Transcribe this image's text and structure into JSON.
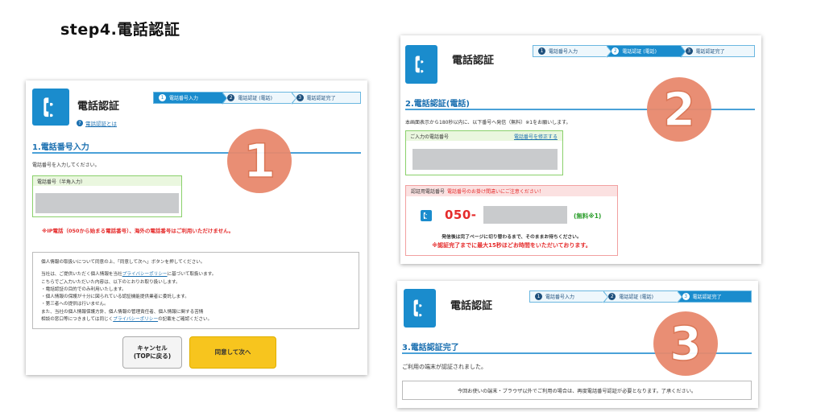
{
  "page_heading": "step4.電話認証",
  "app_title": "電話認証",
  "steps": [
    {
      "num": "1",
      "label": "電話番号入力"
    },
    {
      "num": "2",
      "label": "電話認証 (電話)"
    },
    {
      "num": "3",
      "label": "電話認証完了"
    }
  ],
  "panel1": {
    "help_link": "電話認証とは",
    "section_title": "1.電話番号入力",
    "instruction": "電話番号を入力してください。",
    "field_label": "電話番号（半角入力）",
    "warning": "※IP電話（050から始まる電話番号）、海外の電話番号はご利用いただけません。",
    "privacy": {
      "intro": "個人情報の取扱いについて同意の上、「同意して次へ」ボタンを押してください。",
      "line1_pre": "当社は、ご提供いただく個人情報を当社",
      "policy_link": "プライバシーポリシー",
      "line1_post": "に基づいて取扱います。",
      "line2": "こちらでご入力いただいた内容は、以下のとおりお取り扱いします。",
      "line3": "・電話認証の目的でのみ利用いたします。",
      "line4": "・個人情報の保護が十分に図られている認証機能提供業者に委託します。",
      "line5": "・第三者への提供は行いません。",
      "line6": "また、当社の個人情報保護方針、個人情報の管理責任者、個人情報に関する苦情",
      "line7_pre": "相談の窓口等につきましては同じく",
      "line7_post": "の記載をご確認ください。"
    },
    "cancel_line1": "キャンセル",
    "cancel_line2": "(TOPに戻る)",
    "agree_label": "同意して次へ"
  },
  "panel2": {
    "section_title": "2.電話認証(電話)",
    "instruction": "本画面表示から180秒以内に、以下番号へ発信（無料）※1をお願いします。",
    "field_label": "ご入力の電話番号",
    "edit_link": "電話番号を修正する",
    "auth_label": "認証用電話番号",
    "auth_caution": "電話番号のお掛け間違いにご注意ください！",
    "auth_number_prefix": "050-",
    "auth_free": "(無料※1)",
    "note1": "発信後は完了ページに切り替わるまで、そのままお待ちください。",
    "note2": "※認証完了までに最大15秒ほどお時間をいただいております。"
  },
  "panel3": {
    "section_title": "3.電話認証完了",
    "message": "ご利用の端末が認証されました。",
    "notice": "今回お使いの端末・ブラウザ以外でご利用の場合は、再度電話番号認証が必要となります。了承ください。"
  },
  "badges": [
    "1",
    "2",
    "3"
  ],
  "colors": {
    "brand_blue": "#1a8ccd",
    "badge_orange": "#e8896d",
    "agree_yellow": "#f7c51e",
    "warning_red": "#e52b2b"
  }
}
